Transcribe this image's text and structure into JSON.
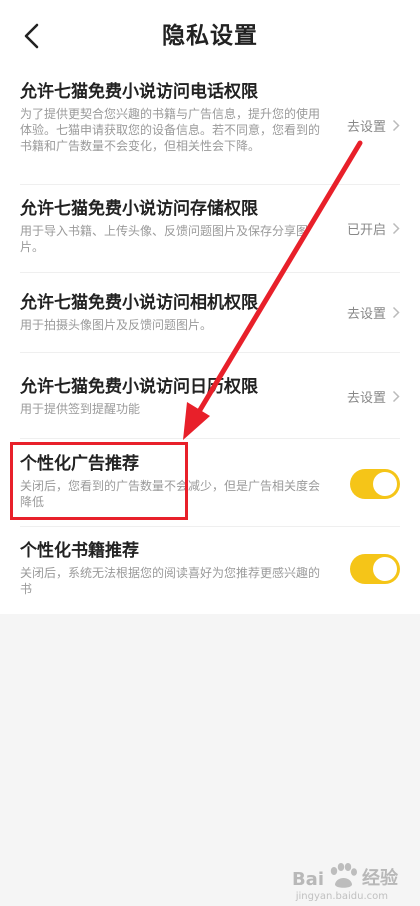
{
  "header": {
    "title": "隐私设置"
  },
  "permissions": [
    {
      "title": "允许七猫免费小说访问电话权限",
      "desc": "为了提供更契合您兴趣的书籍与广告信息，提升您的使用体验。七猫申请获取您的设备信息。若不同意，您看到的书籍和广告数量不会变化，但相关性会下降。",
      "action": "去设置"
    },
    {
      "title": "允许七猫免费小说访问存储权限",
      "desc": "用于导入书籍、上传头像、反馈问题图片及保存分享图片。",
      "action": "已开启"
    },
    {
      "title": "允许七猫免费小说访问相机权限",
      "desc": "用于拍摄头像图片及反馈问题图片。",
      "action": "去设置"
    },
    {
      "title": "允许七猫免费小说访问日历权限",
      "desc": "用于提供签到提醒功能",
      "action": "去设置"
    }
  ],
  "toggles": [
    {
      "title": "个性化广告推荐",
      "desc": "关闭后，您看到的广告数量不会减少，但是广告相关度会降低",
      "on": true
    },
    {
      "title": "个性化书籍推荐",
      "desc": "关闭后，系统无法根据您的阅读喜好为您推荐更感兴趣的书",
      "on": true
    }
  ],
  "colors": {
    "toggle_on": "#f5c518",
    "highlight": "#e8202a"
  },
  "watermark": {
    "brand_left": "Bai",
    "brand_right": "经验",
    "sub": "jingyan.baidu.com"
  }
}
